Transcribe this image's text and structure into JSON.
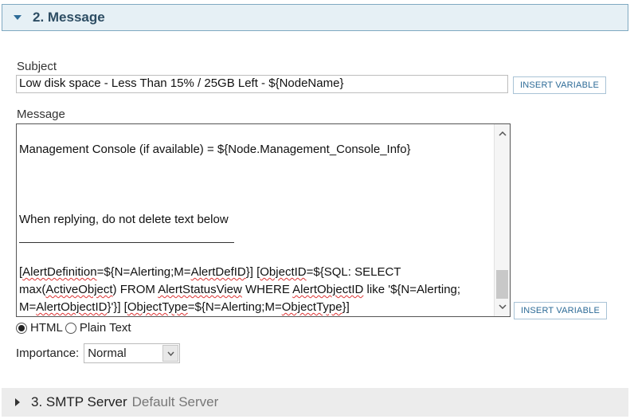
{
  "section_message": {
    "title": "2. Message"
  },
  "subject": {
    "label": "Subject",
    "value": "Low disk space - Less Than 15% / 25GB Left - ${NodeName}",
    "insert_label": "INSERT VARIABLE"
  },
  "message": {
    "label": "Message",
    "lines": {
      "l1": "Management Console (if available) = ${Node.Management_Console_Info}",
      "l2": "When replying, do not delete text below",
      "l3_parts": [
        "[",
        "AlertDefinition",
        "=${N=Alerting;M=",
        "AlertDefID",
        "}] [",
        "ObjectID",
        "=${SQL: SELECT"
      ],
      "l4_parts": [
        "max(",
        "ActiveObject",
        ") FROM ",
        "AlertStatusView",
        " WHERE ",
        "AlertObjectID",
        " like '${N=Alerting;"
      ],
      "l5_parts": [
        "M=",
        "AlertObjectID",
        "}'}] [",
        "ObjectType",
        "=${N=Alerting;M=",
        "ObjectType",
        "}]"
      ]
    },
    "insert_label": "INSERT VARIABLE"
  },
  "format": {
    "html_label": "HTML",
    "plain_label": "Plain Text",
    "selected": "HTML"
  },
  "importance": {
    "label": "Importance:",
    "value": "Normal"
  },
  "section_smtp": {
    "title": "3. SMTP Server",
    "subtitle": "Default Server"
  },
  "icons": {
    "expand": "caret-down-icon",
    "collapse": "caret-right-icon",
    "scroll_up": "chevron-up-icon",
    "scroll_down": "chevron-down-icon"
  }
}
